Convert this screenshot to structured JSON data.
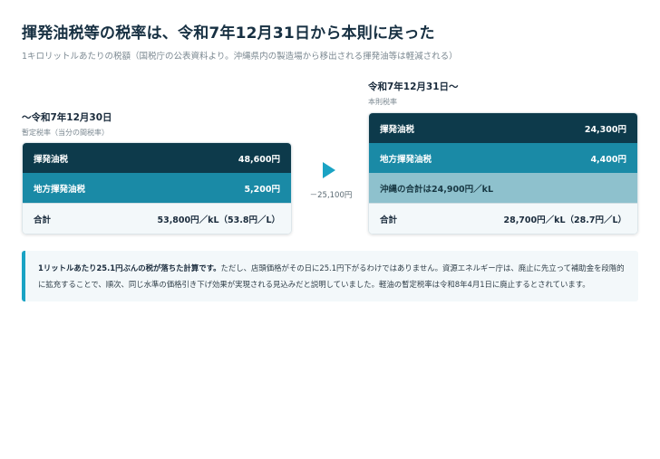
{
  "header": {
    "title": "揮発油税等の税率は、令和7年12月31日から本則に戻った",
    "subtitle": "1キロリットルあたりの税額（国税庁の公表資料より。沖縄県内の製造場から移出される揮発油等は軽減される）"
  },
  "left": {
    "date": "〜令和7年12月30日",
    "note": "暫定税率（当分の間税率）",
    "rows": [
      {
        "label": "揮発油税",
        "value": "48,600円"
      },
      {
        "label": "地方揮発油税",
        "value": "5,200円"
      }
    ],
    "total_label": "合計",
    "total_value": "53,800円／kL（53.8円／L）"
  },
  "right": {
    "date": "令和7年12月31日〜",
    "note": "本則税率",
    "rows": [
      {
        "label": "揮発油税",
        "value": "24,300円"
      },
      {
        "label": "地方揮発油税",
        "value": "4,400円"
      }
    ],
    "okinawa": "沖縄の合計は24,900円／kL",
    "total_label": "合計",
    "total_value": "28,700円／kL（28.7円／L）"
  },
  "diff": "－25,100円",
  "callout": {
    "lead": "1リットルあたり25.1円ぶんの税が落ちた計算です。",
    "body": "ただし、店頭価格がその日に25.1円下がるわけではありません。資源エネルギー庁は、廃止に先立って補助金を段階的に拡充することで、順次、同じ水準の価格引き下げ効果が実現される見込みだと説明していました。軽油の暫定税率は令和8年4月1日に廃止するとされています。"
  },
  "colors": {
    "dark": "#0d3a4b",
    "mid": "#1a8aa6",
    "light": "#8ec1cd",
    "accent": "#1aa3c4"
  }
}
